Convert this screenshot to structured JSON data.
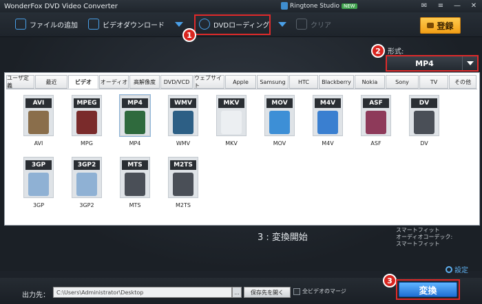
{
  "window": {
    "title": "WonderFox DVD Video Converter",
    "ringtone_label": "Ringtone Studio",
    "new_badge": "NEW"
  },
  "toolbar": {
    "add_files": "ファイルの追加",
    "video_download": "ビデオダウンロード",
    "dvd_loading": "DVDローディング",
    "clear": "クリア",
    "register": "登録"
  },
  "callouts": {
    "one": "1",
    "two": "2",
    "three": "3"
  },
  "format": {
    "label": "形式:",
    "value": "MP4"
  },
  "tabs": [
    "ユーザ定義",
    "最近",
    "ビデオ",
    "オーディオ",
    "高解像度",
    "DVD/VCD",
    "ウェブサイト",
    "Apple",
    "Samsung",
    "HTC",
    "Blackberry",
    "Nokia",
    "Sony",
    "TV",
    "その他"
  ],
  "active_tab": "ビデオ",
  "formats": [
    {
      "tag": "AVI",
      "label": "AVI",
      "color": "#8a6e4b"
    },
    {
      "tag": "MPEG",
      "label": "MPG",
      "color": "#7a2b2b"
    },
    {
      "tag": "MP4",
      "label": "MP4",
      "color": "#2f6a3d"
    },
    {
      "tag": "WMV",
      "label": "WMV",
      "color": "#2d5f85"
    },
    {
      "tag": "MKV",
      "label": "MKV",
      "color": "#eceff2"
    },
    {
      "tag": "MOV",
      "label": "MOV",
      "color": "#3d8fd6"
    },
    {
      "tag": "M4V",
      "label": "M4V",
      "color": "#3a7fd0"
    },
    {
      "tag": "ASF",
      "label": "ASF",
      "color": "#8e3a5a"
    },
    {
      "tag": "DV",
      "label": "DV",
      "color": "#4a4f57"
    },
    {
      "tag": "3GP",
      "label": "3GP",
      "color": "#8fb1d4"
    },
    {
      "tag": "3GP2",
      "label": "3GP2",
      "color": "#8fb1d4"
    },
    {
      "tag": "MTS",
      "label": "MTS",
      "color": "#4a4f57"
    },
    {
      "tag": "M2TS",
      "label": "M2TS",
      "color": "#4a4f57"
    }
  ],
  "step3": "3 : 変換開始",
  "smart_info": [
    "スマートフィット",
    "オーディオコーデック:",
    "スマートフィット"
  ],
  "settings_label": "設定",
  "output": {
    "label": "出力先：",
    "path": "C:\\Users\\Administrator\\Desktop",
    "browse": "...",
    "open_folder": "保存先を開く",
    "merge": "全ビデオのマージ"
  },
  "convert_label": "変換"
}
